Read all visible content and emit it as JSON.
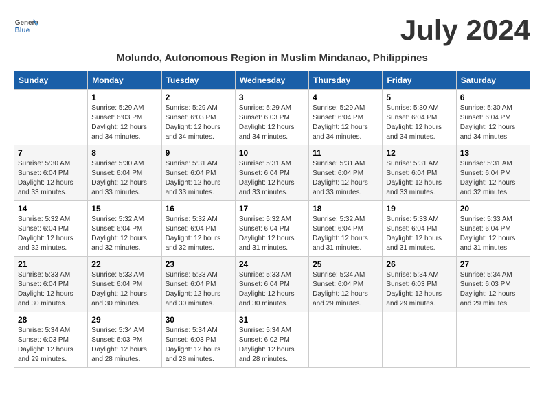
{
  "header": {
    "logo_general": "General",
    "logo_blue": "Blue",
    "month_year": "July 2024",
    "location": "Molundo, Autonomous Region in Muslim Mindanao, Philippines"
  },
  "weekdays": [
    "Sunday",
    "Monday",
    "Tuesday",
    "Wednesday",
    "Thursday",
    "Friday",
    "Saturday"
  ],
  "weeks": [
    [
      {
        "day": null,
        "info": null
      },
      {
        "day": "1",
        "info": "Sunrise: 5:29 AM\nSunset: 6:03 PM\nDaylight: 12 hours\nand 34 minutes."
      },
      {
        "day": "2",
        "info": "Sunrise: 5:29 AM\nSunset: 6:03 PM\nDaylight: 12 hours\nand 34 minutes."
      },
      {
        "day": "3",
        "info": "Sunrise: 5:29 AM\nSunset: 6:03 PM\nDaylight: 12 hours\nand 34 minutes."
      },
      {
        "day": "4",
        "info": "Sunrise: 5:29 AM\nSunset: 6:04 PM\nDaylight: 12 hours\nand 34 minutes."
      },
      {
        "day": "5",
        "info": "Sunrise: 5:30 AM\nSunset: 6:04 PM\nDaylight: 12 hours\nand 34 minutes."
      },
      {
        "day": "6",
        "info": "Sunrise: 5:30 AM\nSunset: 6:04 PM\nDaylight: 12 hours\nand 34 minutes."
      }
    ],
    [
      {
        "day": "7",
        "info": "Sunrise: 5:30 AM\nSunset: 6:04 PM\nDaylight: 12 hours\nand 33 minutes."
      },
      {
        "day": "8",
        "info": "Sunrise: 5:30 AM\nSunset: 6:04 PM\nDaylight: 12 hours\nand 33 minutes."
      },
      {
        "day": "9",
        "info": "Sunrise: 5:31 AM\nSunset: 6:04 PM\nDaylight: 12 hours\nand 33 minutes."
      },
      {
        "day": "10",
        "info": "Sunrise: 5:31 AM\nSunset: 6:04 PM\nDaylight: 12 hours\nand 33 minutes."
      },
      {
        "day": "11",
        "info": "Sunrise: 5:31 AM\nSunset: 6:04 PM\nDaylight: 12 hours\nand 33 minutes."
      },
      {
        "day": "12",
        "info": "Sunrise: 5:31 AM\nSunset: 6:04 PM\nDaylight: 12 hours\nand 33 minutes."
      },
      {
        "day": "13",
        "info": "Sunrise: 5:31 AM\nSunset: 6:04 PM\nDaylight: 12 hours\nand 32 minutes."
      }
    ],
    [
      {
        "day": "14",
        "info": "Sunrise: 5:32 AM\nSunset: 6:04 PM\nDaylight: 12 hours\nand 32 minutes."
      },
      {
        "day": "15",
        "info": "Sunrise: 5:32 AM\nSunset: 6:04 PM\nDaylight: 12 hours\nand 32 minutes."
      },
      {
        "day": "16",
        "info": "Sunrise: 5:32 AM\nSunset: 6:04 PM\nDaylight: 12 hours\nand 32 minutes."
      },
      {
        "day": "17",
        "info": "Sunrise: 5:32 AM\nSunset: 6:04 PM\nDaylight: 12 hours\nand 31 minutes."
      },
      {
        "day": "18",
        "info": "Sunrise: 5:32 AM\nSunset: 6:04 PM\nDaylight: 12 hours\nand 31 minutes."
      },
      {
        "day": "19",
        "info": "Sunrise: 5:33 AM\nSunset: 6:04 PM\nDaylight: 12 hours\nand 31 minutes."
      },
      {
        "day": "20",
        "info": "Sunrise: 5:33 AM\nSunset: 6:04 PM\nDaylight: 12 hours\nand 31 minutes."
      }
    ],
    [
      {
        "day": "21",
        "info": "Sunrise: 5:33 AM\nSunset: 6:04 PM\nDaylight: 12 hours\nand 30 minutes."
      },
      {
        "day": "22",
        "info": "Sunrise: 5:33 AM\nSunset: 6:04 PM\nDaylight: 12 hours\nand 30 minutes."
      },
      {
        "day": "23",
        "info": "Sunrise: 5:33 AM\nSunset: 6:04 PM\nDaylight: 12 hours\nand 30 minutes."
      },
      {
        "day": "24",
        "info": "Sunrise: 5:33 AM\nSunset: 6:04 PM\nDaylight: 12 hours\nand 30 minutes."
      },
      {
        "day": "25",
        "info": "Sunrise: 5:34 AM\nSunset: 6:04 PM\nDaylight: 12 hours\nand 29 minutes."
      },
      {
        "day": "26",
        "info": "Sunrise: 5:34 AM\nSunset: 6:03 PM\nDaylight: 12 hours\nand 29 minutes."
      },
      {
        "day": "27",
        "info": "Sunrise: 5:34 AM\nSunset: 6:03 PM\nDaylight: 12 hours\nand 29 minutes."
      }
    ],
    [
      {
        "day": "28",
        "info": "Sunrise: 5:34 AM\nSunset: 6:03 PM\nDaylight: 12 hours\nand 29 minutes."
      },
      {
        "day": "29",
        "info": "Sunrise: 5:34 AM\nSunset: 6:03 PM\nDaylight: 12 hours\nand 28 minutes."
      },
      {
        "day": "30",
        "info": "Sunrise: 5:34 AM\nSunset: 6:03 PM\nDaylight: 12 hours\nand 28 minutes."
      },
      {
        "day": "31",
        "info": "Sunrise: 5:34 AM\nSunset: 6:02 PM\nDaylight: 12 hours\nand 28 minutes."
      },
      {
        "day": null,
        "info": null
      },
      {
        "day": null,
        "info": null
      },
      {
        "day": null,
        "info": null
      }
    ]
  ]
}
